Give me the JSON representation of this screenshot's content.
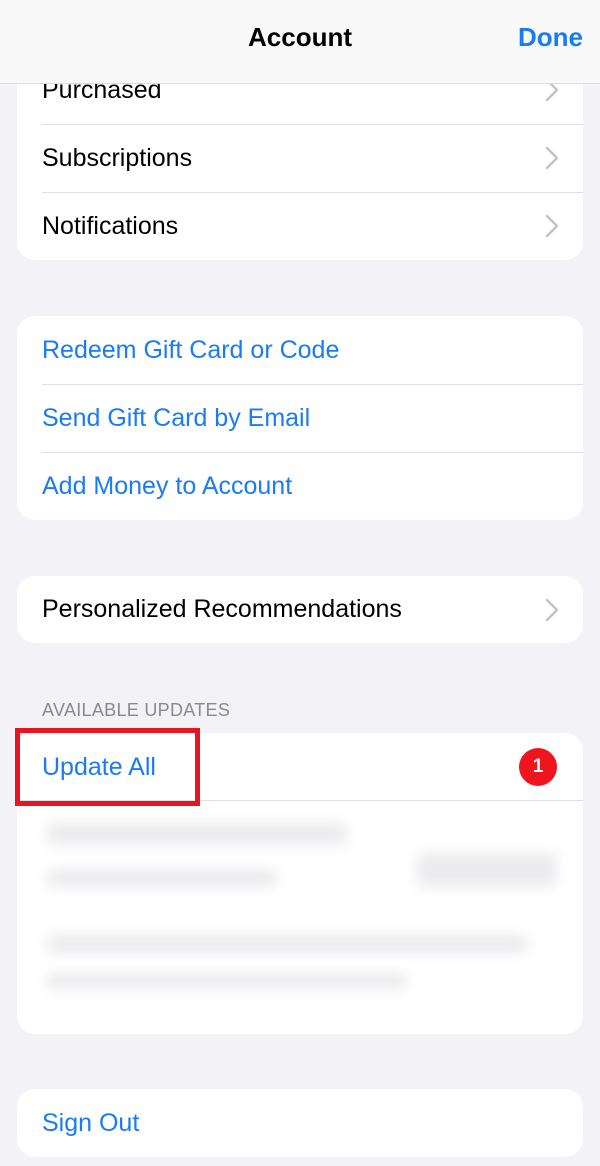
{
  "navbar": {
    "title": "Account",
    "done_label": "Done"
  },
  "account_list": {
    "items": [
      {
        "label": "Purchased"
      },
      {
        "label": "Subscriptions"
      },
      {
        "label": "Notifications"
      }
    ]
  },
  "gift_actions": {
    "items": [
      {
        "label": "Redeem Gift Card or Code"
      },
      {
        "label": "Send Gift Card by Email"
      },
      {
        "label": "Add Money to Account"
      }
    ]
  },
  "recommendations": {
    "label": "Personalized Recommendations"
  },
  "updates": {
    "section_header": "AVAILABLE UPDATES",
    "update_all_label": "Update All",
    "badge_count": "1"
  },
  "sign_out": {
    "label": "Sign Out"
  },
  "colors": {
    "accent": "#1a7bf2",
    "badge": "#f0141e",
    "highlight": "#e8141e",
    "background": "#f2f2f7"
  },
  "icons": {
    "disclosure": "chevron-right-icon"
  }
}
